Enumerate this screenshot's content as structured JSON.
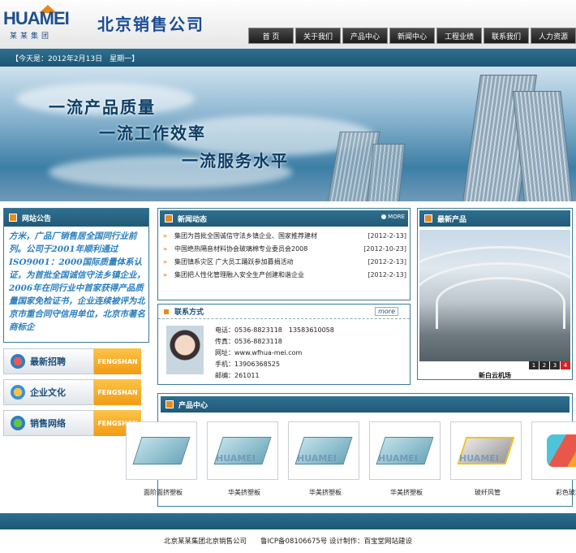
{
  "header": {
    "logo_text": "HUAMEI",
    "logo_sub": "某某集团",
    "company_name": "北京销售公司"
  },
  "nav": [
    "首  页",
    "关于我们",
    "产品中心",
    "新闻中心",
    "工程业绩",
    "联系我们",
    "人力资源"
  ],
  "datebar": {
    "text": "【今天是：2012年2月13日　星期一】"
  },
  "banner": {
    "slogans": [
      "一流产品质量",
      "一流工作效率",
      "一流服务水平"
    ]
  },
  "notice": {
    "title": "网站公告",
    "text": "方米，广品厂销售居全国同行业前列。公司于2001年顺利通过ISO9001：2000国际质量体系认证，为首批全国诚信守法乡镇企业，2006年在同行业中首家获得产品质量国家免检证书，企业连续被评为北京市重合同守信用单位，北京市著名商标企"
  },
  "side_buttons": [
    {
      "label": "最新招聘",
      "tag": "FENGSHAN",
      "icon": "recruit-icon"
    },
    {
      "label": "企业文化",
      "tag": "FENGSHAN",
      "icon": "culture-icon"
    },
    {
      "label": "销售网络",
      "tag": "FENGSHAN",
      "icon": "network-icon"
    }
  ],
  "news": {
    "title": "新闻动态",
    "more": "MORE",
    "items": [
      {
        "title": "集团为首批全国诚信守法乡镇企业、国家推荐建材",
        "date": "[2012-2-13]"
      },
      {
        "title": "中国绝热隔音材料协会玻璃棉专业委员会2008",
        "date": "[2012-10-23]"
      },
      {
        "title": "集团镇系灾区 广大员工踊跃参加募捐活动",
        "date": "[2012-2-13]"
      },
      {
        "title": "集团把人性化管理融入安全生产创建和谐企业",
        "date": "[2012-2-13]"
      }
    ]
  },
  "contact": {
    "title": "联系方式",
    "more": "more",
    "lines": [
      "电话：0536-8823118　13583610058",
      "传真：0536-8823118",
      "网址：www.wfhua-mei.com",
      "手机：13906368525",
      "邮编：261011"
    ]
  },
  "latest": {
    "title": "最新产品",
    "pages": [
      "1",
      "2",
      "3",
      "4"
    ],
    "active_page": 3,
    "caption": "新白云机场"
  },
  "products": {
    "title": "产品中心",
    "items": [
      {
        "label": "面阶面挤塑板",
        "watermark": ""
      },
      {
        "label": "华美挤塑板",
        "watermark": "HUAMEI"
      },
      {
        "label": "华美挤塑板",
        "watermark": "HUAMEI"
      },
      {
        "label": "华美挤塑板",
        "watermark": "HUAMEI"
      },
      {
        "label": "玻纤风管",
        "watermark": "HUAMEI"
      },
      {
        "label": "彩色玻璃",
        "watermark": ""
      }
    ]
  },
  "footer": {
    "text": "北京某某集团北京销售公司　　鲁ICP备08106675号 设计制作：百宝堂网站建设"
  },
  "colors": {
    "primary": "#215a79",
    "accent": "#f29b14",
    "link": "#2a7fc0"
  }
}
